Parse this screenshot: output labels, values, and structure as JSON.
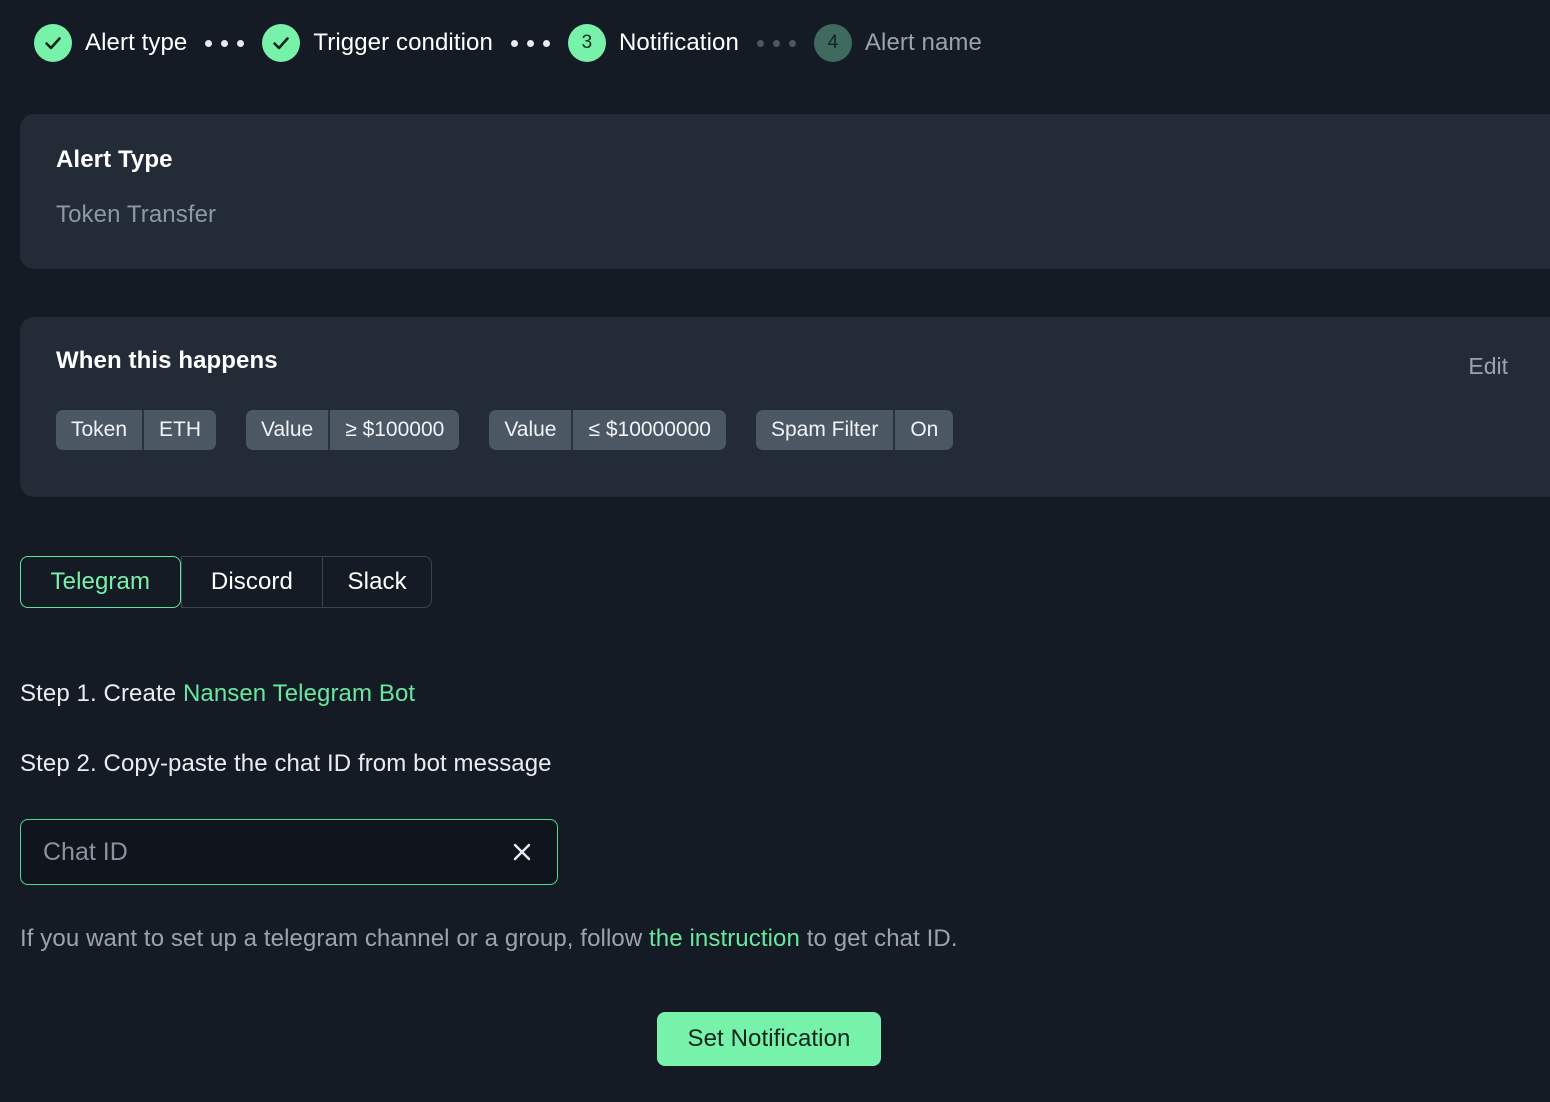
{
  "stepper": {
    "steps": [
      {
        "id": "alert-type",
        "badge": "check",
        "label": "Alert type",
        "state": "done"
      },
      {
        "id": "trigger-condition",
        "badge": "check",
        "label": "Trigger condition",
        "state": "done"
      },
      {
        "id": "notification",
        "badge": "3",
        "label": "Notification",
        "state": "active"
      },
      {
        "id": "alert-name",
        "badge": "4",
        "label": "Alert name",
        "state": "todo"
      }
    ]
  },
  "alert_type_card": {
    "title": "Alert Type",
    "value": "Token Transfer"
  },
  "trigger_card": {
    "title": "When this happens",
    "edit_label": "Edit",
    "chips": [
      {
        "key": "Token",
        "value": "ETH"
      },
      {
        "key": "Value",
        "value": "≥ $100000"
      },
      {
        "key": "Value",
        "value": "≤ $10000000"
      },
      {
        "key": "Spam Filter",
        "value": "On"
      }
    ]
  },
  "channel_tabs": {
    "items": [
      {
        "id": "telegram",
        "label": "Telegram",
        "selected": true
      },
      {
        "id": "discord",
        "label": "Discord",
        "selected": false
      },
      {
        "id": "slack",
        "label": "Slack",
        "selected": false
      }
    ]
  },
  "instructions": {
    "step1_prefix": "Step 1. Create ",
    "step1_link": "Nansen Telegram Bot",
    "step2": "Step 2. Copy-paste the chat ID from bot message"
  },
  "chat_id_field": {
    "placeholder": "Chat ID",
    "value": "",
    "clear_icon": "close-icon"
  },
  "helper_text": {
    "before": "If you want to set up a telegram channel or a group, follow ",
    "link": "the instruction",
    "after": " to get chat ID."
  },
  "submit": {
    "label": "Set Notification"
  },
  "colors": {
    "page_bg": "#151b24",
    "card_bg": "#222b36",
    "accent_green": "#76f2ab",
    "link_green": "#6ae79f",
    "chip_bg": "#4c5764",
    "muted_text": "#9aa4b1",
    "step_todo_bg": "#3e6b5d",
    "input_bg": "#10151d",
    "input_border": "#4fd98d"
  }
}
